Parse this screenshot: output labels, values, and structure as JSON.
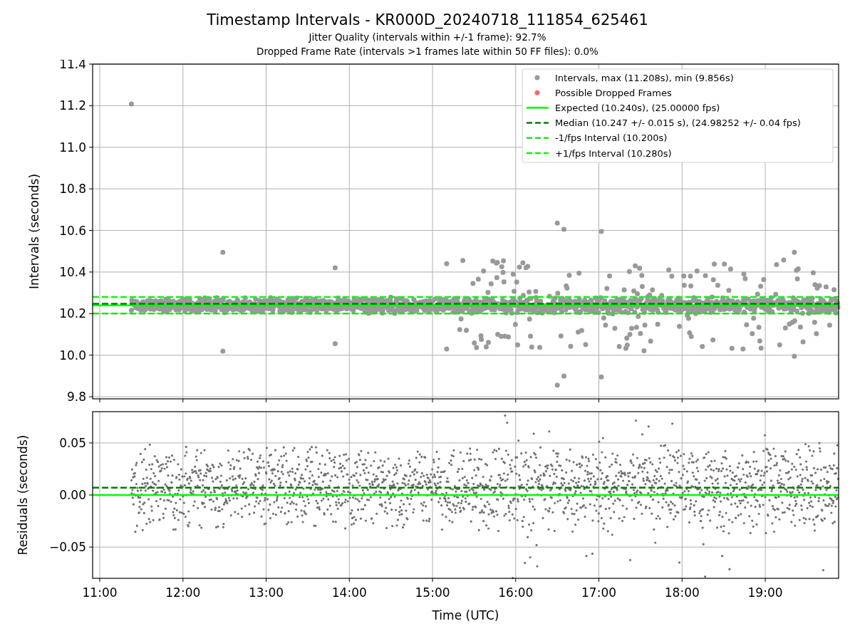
{
  "figure": {
    "title": "Timestamp Intervals - KR000D_20240718_111854_625461",
    "subtitles": [
      "Jitter Quality (intervals within +/-1 frame): 92.7%",
      "Dropped Frame Rate (intervals >1 frames late within 50 FF files): 0.0%"
    ]
  },
  "intervals_panel": {
    "legend_markers": [
      {
        "color": "#999999",
        "label": "Intervals, max (11.208s), min (9.856s)"
      },
      {
        "color": "#ff6666",
        "label": "Possible Dropped Frames"
      }
    ],
    "chart_data": {
      "type": "line",
      "legend": true,
      "ylabel": "Intervals (seconds)",
      "grid": true,
      "xlim": [
        10.914,
        19.882
      ],
      "ylim": [
        9.79,
        11.4
      ],
      "yticks": [
        {
          "value": 9.8,
          "label": "9.8"
        },
        {
          "value": 10.0,
          "label": "10.0"
        },
        {
          "value": 10.2,
          "label": "10.2"
        },
        {
          "value": 10.4,
          "label": "10.4"
        },
        {
          "value": 10.6,
          "label": "10.6"
        },
        {
          "value": 10.8,
          "label": "10.8"
        },
        {
          "value": 11.0,
          "label": "11.0"
        },
        {
          "value": 11.2,
          "label": "11.2"
        },
        {
          "value": 11.4,
          "label": "11.4"
        }
      ],
      "x": [
        10.914,
        19.882
      ],
      "series": [
        {
          "name": "Expected (10.240s), (25.00000 fps)",
          "color": "#00ff00",
          "line_style": "solid",
          "values": [
            10.24,
            10.24
          ]
        },
        {
          "name": "Median (10.247 +/- 0.015 s), (24.98252 +/- 0.04 fps)",
          "color": "#008000",
          "line_style": "dashed",
          "values": [
            10.247,
            10.247
          ]
        },
        {
          "name": "-1/fps Interval (10.200s)",
          "color": "#22e022",
          "line_style": "dashed",
          "values": [
            10.2,
            10.2
          ]
        },
        {
          "name": "+1/fps Interval (10.280s)",
          "color": "#00ff00",
          "line_style": "dashed",
          "values": [
            10.28,
            10.28
          ]
        }
      ]
    }
  },
  "residuals_panel": {
    "chart_data": {
      "type": "line",
      "xlabel": "Time (UTC)",
      "ylabel": "Residuals (seconds)",
      "grid": true,
      "xlim": [
        10.914,
        19.882
      ],
      "ylim": [
        -0.08,
        0.08
      ],
      "xticks": [
        {
          "value": 11,
          "label": "11:00"
        },
        {
          "value": 12,
          "label": "12:00"
        },
        {
          "value": 13,
          "label": "13:00"
        },
        {
          "value": 14,
          "label": "14:00"
        },
        {
          "value": 15,
          "label": "15:00"
        },
        {
          "value": 16,
          "label": "16:00"
        },
        {
          "value": 17,
          "label": "17:00"
        },
        {
          "value": 18,
          "label": "18:00"
        },
        {
          "value": 19,
          "label": "19:00"
        }
      ],
      "yticks": [
        {
          "value": 0.05,
          "label": "0.05"
        },
        {
          "value": 0,
          "label": "0.00"
        },
        {
          "value": -0.05,
          "label": "−0.05"
        }
      ],
      "x": [
        10.914,
        19.882
      ],
      "series": [
        {
          "color": "#00ff00",
          "line_style": "solid",
          "values": [
            0,
            0
          ]
        },
        {
          "color": "#008000",
          "line_style": "dashed",
          "values": [
            0.007,
            0.007
          ]
        }
      ]
    }
  }
}
